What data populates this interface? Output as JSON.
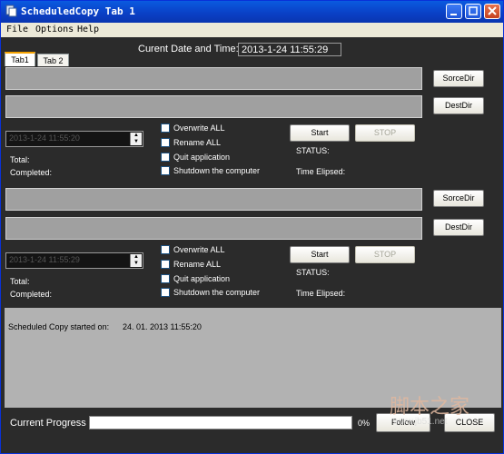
{
  "window": {
    "title": "ScheduledCopy Tab 1"
  },
  "menu": [
    "File",
    "Options",
    "Help"
  ],
  "header": {
    "date_label": "Curent Date and Time:",
    "date_value": "2013-1-24 11:55:29"
  },
  "tabs": [
    {
      "label": "Tab1",
      "active": true
    },
    {
      "label": "Tab 2",
      "active": false
    }
  ],
  "group1": {
    "source_button": "SorceDir",
    "dest_button": "DestDir",
    "datetime": "2013-1-24 11:55:20",
    "total_label": "Total:",
    "completed_label": "Completed:",
    "options": [
      "Overwrite ALL",
      "Rename ALL",
      "Quit application",
      "Shutdown the computer"
    ],
    "start_button": "Start",
    "stop_button": "STOP",
    "status_label": "STATUS:",
    "time_label": "Time Elipsed:"
  },
  "group2": {
    "source_button": "SorceDir",
    "dest_button": "DestDir",
    "datetime": "2013-1-24 11:55:29",
    "total_label": "Total:",
    "completed_label": "Completed:",
    "options": [
      "Overwrite ALL",
      "Rename ALL",
      "Quit application",
      "Shutdown the computer"
    ],
    "start_button": "Start",
    "stop_button": "STOP",
    "status_label": "STATUS:",
    "time_label": "Time Elipsed:"
  },
  "log": {
    "message": "Scheduled Copy started on:",
    "timestamp": "24. 01. 2013  11:55:20"
  },
  "footer": {
    "progress_label": "Current Progress",
    "progress_value": 0,
    "progress_percent": "0%",
    "follow_button": "Follow",
    "close_button": "CLOSE",
    "watermark": "脚本之家",
    "watermark_sub": "www.jb51.net"
  },
  "colors": {
    "titlebar": "#0a4fd6",
    "background": "#2b2b2b",
    "field": "#a0a0a0",
    "log_bg": "#b2b2b2"
  }
}
